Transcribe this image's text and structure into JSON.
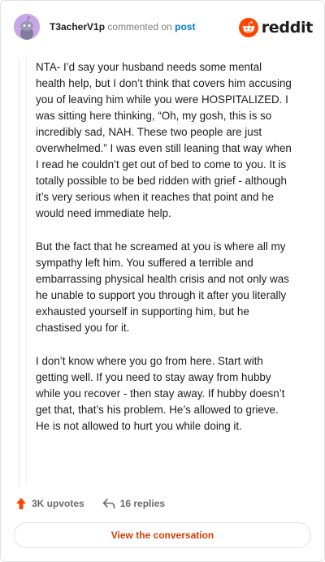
{
  "header": {
    "username": "T3acherV1p",
    "action_text": "commented on",
    "post_link": "post",
    "brand_name": "reddit"
  },
  "comment": {
    "paragraphs": [
      "NTA- I’d say your husband needs some mental health help, but I don’t think that covers him accusing you of leaving him while you were HOSPITALIZED. I was sitting here thinking, “Oh, my gosh, this is so incredibly sad, NAH. These two people are just overwhelmed.” I was even still leaning that way when I read he couldn’t get out of bed to come to you. It is totally possible to be bed ridden with grief - although it’s very serious when it reaches that point and he would need immediate help.",
      "But the fact that he screamed at you is where all my sympathy left him. You suffered a terrible and embarrassing physical health crisis and not only was he unable to support you through it after you literally exhausted yourself in supporting him, but he chastised you for it.",
      "I don’t know where you go from here. Start with getting well. If you need to stay away from hubby while you recover - then stay away. If hubby doesn’t get that, that’s his problem. He’s allowed to grieve. He is not allowed to hurt you while doing it."
    ]
  },
  "footer": {
    "upvotes": "3K upvotes",
    "replies": "16 replies",
    "view_button": "View the conversation"
  },
  "colors": {
    "accent": "#ff4500",
    "link": "#0079d3",
    "button_text": "#d93a00",
    "avatar_bg": "#c9a6e8"
  },
  "icons": {
    "upvote": "upvote-arrow-icon",
    "replies": "reply-arrow-icon",
    "brand": "reddit-snoo-icon"
  }
}
